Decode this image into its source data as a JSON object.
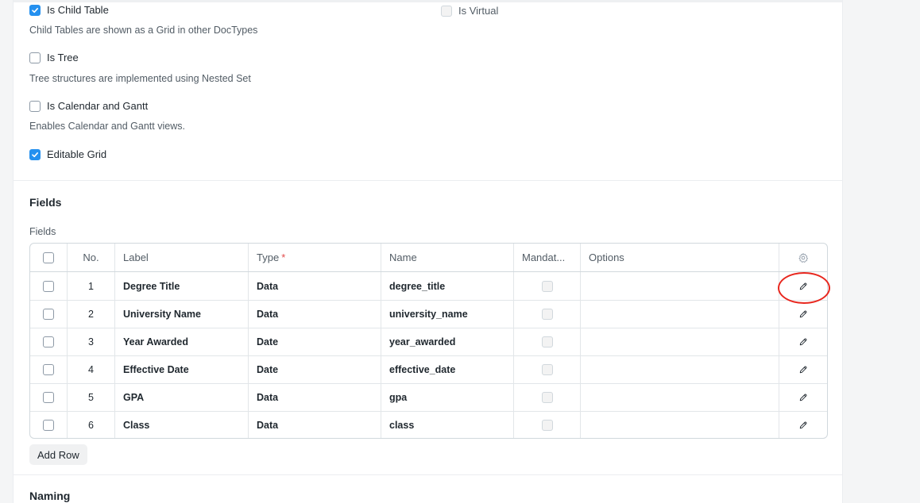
{
  "settings": {
    "is_child_table": {
      "label": "Is Child Table",
      "checked": true
    },
    "child_table_desc": "Child Tables are shown as a Grid in other DocTypes",
    "is_virtual": {
      "label": "Is Virtual",
      "checked": false
    },
    "is_tree": {
      "label": "Is Tree",
      "checked": false
    },
    "tree_desc": "Tree structures are implemented using Nested Set",
    "is_calendar": {
      "label": "Is Calendar and Gantt",
      "checked": false
    },
    "calendar_desc": "Enables Calendar and Gantt views.",
    "editable_grid": {
      "label": "Editable Grid",
      "checked": true
    }
  },
  "fields_section": {
    "title": "Fields",
    "table_label": "Fields",
    "columns": {
      "no": "No.",
      "label": "Label",
      "type": "Type",
      "type_required_mark": "*",
      "name": "Name",
      "mandatory": "Mandat...",
      "options": "Options"
    },
    "rows": [
      {
        "no": "1",
        "label": "Degree Title",
        "type": "Data",
        "name": "degree_title",
        "mandatory": false,
        "options": ""
      },
      {
        "no": "2",
        "label": "University Name",
        "type": "Data",
        "name": "university_name",
        "mandatory": false,
        "options": ""
      },
      {
        "no": "3",
        "label": "Year Awarded",
        "type": "Date",
        "name": "year_awarded",
        "mandatory": false,
        "options": ""
      },
      {
        "no": "4",
        "label": "Effective Date",
        "type": "Date",
        "name": "effective_date",
        "mandatory": false,
        "options": ""
      },
      {
        "no": "5",
        "label": "GPA",
        "type": "Data",
        "name": "gpa",
        "mandatory": false,
        "options": ""
      },
      {
        "no": "6",
        "label": "Class",
        "type": "Data",
        "name": "class",
        "mandatory": false,
        "options": ""
      }
    ],
    "add_row_label": "Add Row"
  },
  "naming_section": {
    "title": "Naming"
  },
  "icons": {
    "check": "check-icon",
    "settings": "gear-icon",
    "edit": "pencil-icon"
  },
  "colors": {
    "accent": "#2490ef",
    "required": "#e24c4c",
    "highlight": "#e8271e"
  }
}
